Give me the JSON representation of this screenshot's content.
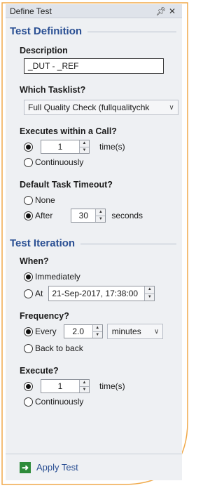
{
  "window": {
    "title": "Define Test",
    "pin_icon": "pin-icon",
    "close_icon": "close-icon"
  },
  "test_definition": {
    "heading": "Test Definition",
    "description_label": "Description",
    "description_value": "_DUT - _REF",
    "tasklist_label": "Which Tasklist?",
    "tasklist_value": "Full Quality Check (fullqualitychk",
    "executes_label": "Executes within a Call?",
    "times_value": "1",
    "times_unit": "time(s)",
    "continuously_label": "Continuously",
    "timeout_label": "Default Task Timeout?",
    "none_label": "None",
    "after_label": "After",
    "timeout_value": "30",
    "timeout_unit": "seconds"
  },
  "test_iteration": {
    "heading": "Test Iteration",
    "when_label": "When?",
    "immediately_label": "Immediately",
    "at_label": "At",
    "at_value": "21-Sep-2017, 17:38:00",
    "frequency_label": "Frequency?",
    "every_label": "Every",
    "every_value": "2.0",
    "every_unit": "minutes",
    "back_to_back_label": "Back to back",
    "execute_label": "Execute?",
    "execute_value": "1",
    "execute_unit": "time(s)",
    "continuously_label": "Continuously"
  },
  "footer": {
    "apply_label": "Apply Test"
  },
  "colors": {
    "accent_frame": "#f0a94a",
    "heading": "#2a4f93",
    "apply_icon": "#2e8b3a"
  }
}
